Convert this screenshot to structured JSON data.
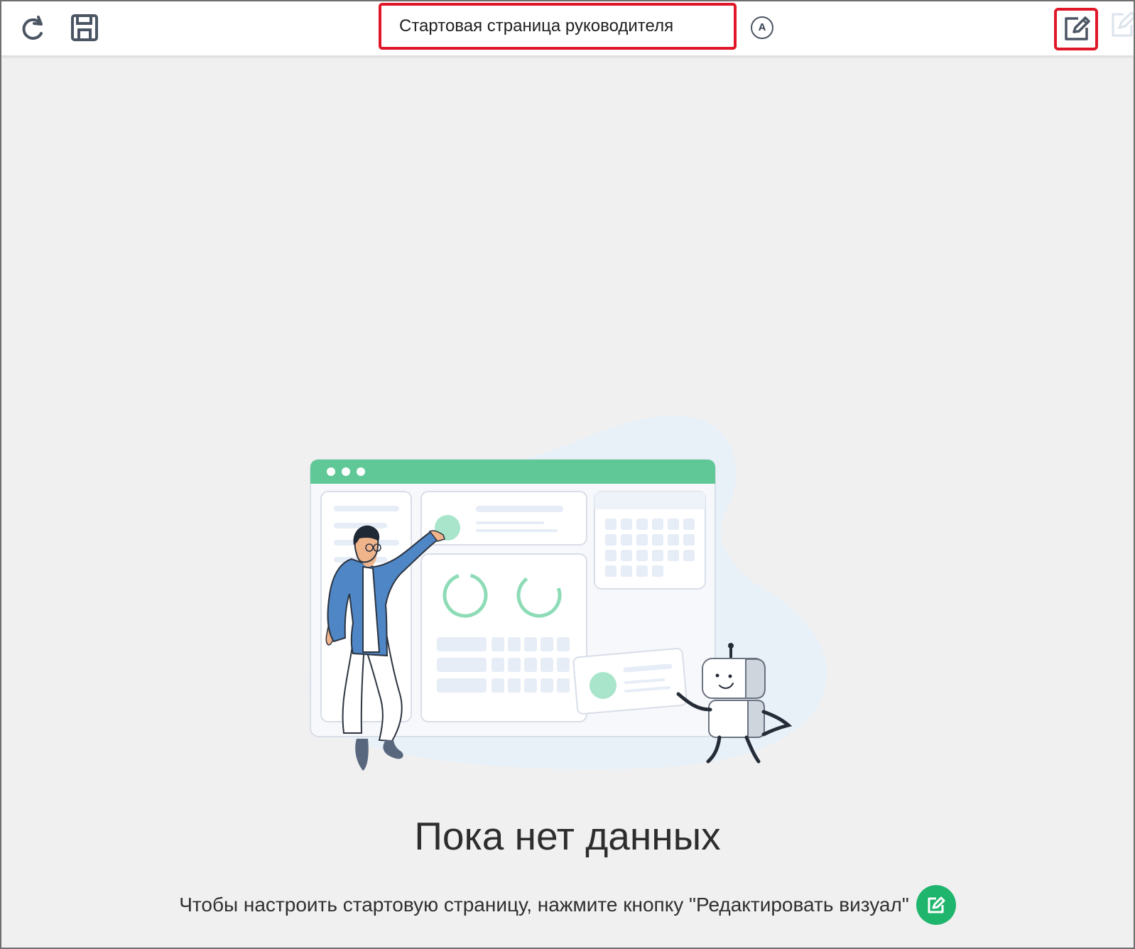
{
  "toolbar": {
    "refresh_icon": "refresh-icon",
    "save_icon": "save-icon",
    "title": "Стартовая страница руководителя",
    "auto_label": "A",
    "edit_icon": "edit-icon"
  },
  "empty_state": {
    "title": "Пока нет данных",
    "hint": "Чтобы настроить стартовую страницу, нажмите кнопку \"Редактировать визуал\"",
    "button_icon": "edit-icon"
  },
  "colors": {
    "highlight": "#e01728",
    "accent_green": "#20b56c",
    "light_green": "#60c896",
    "background": "#f0f0f0",
    "icon_gray": "#4b5563"
  }
}
